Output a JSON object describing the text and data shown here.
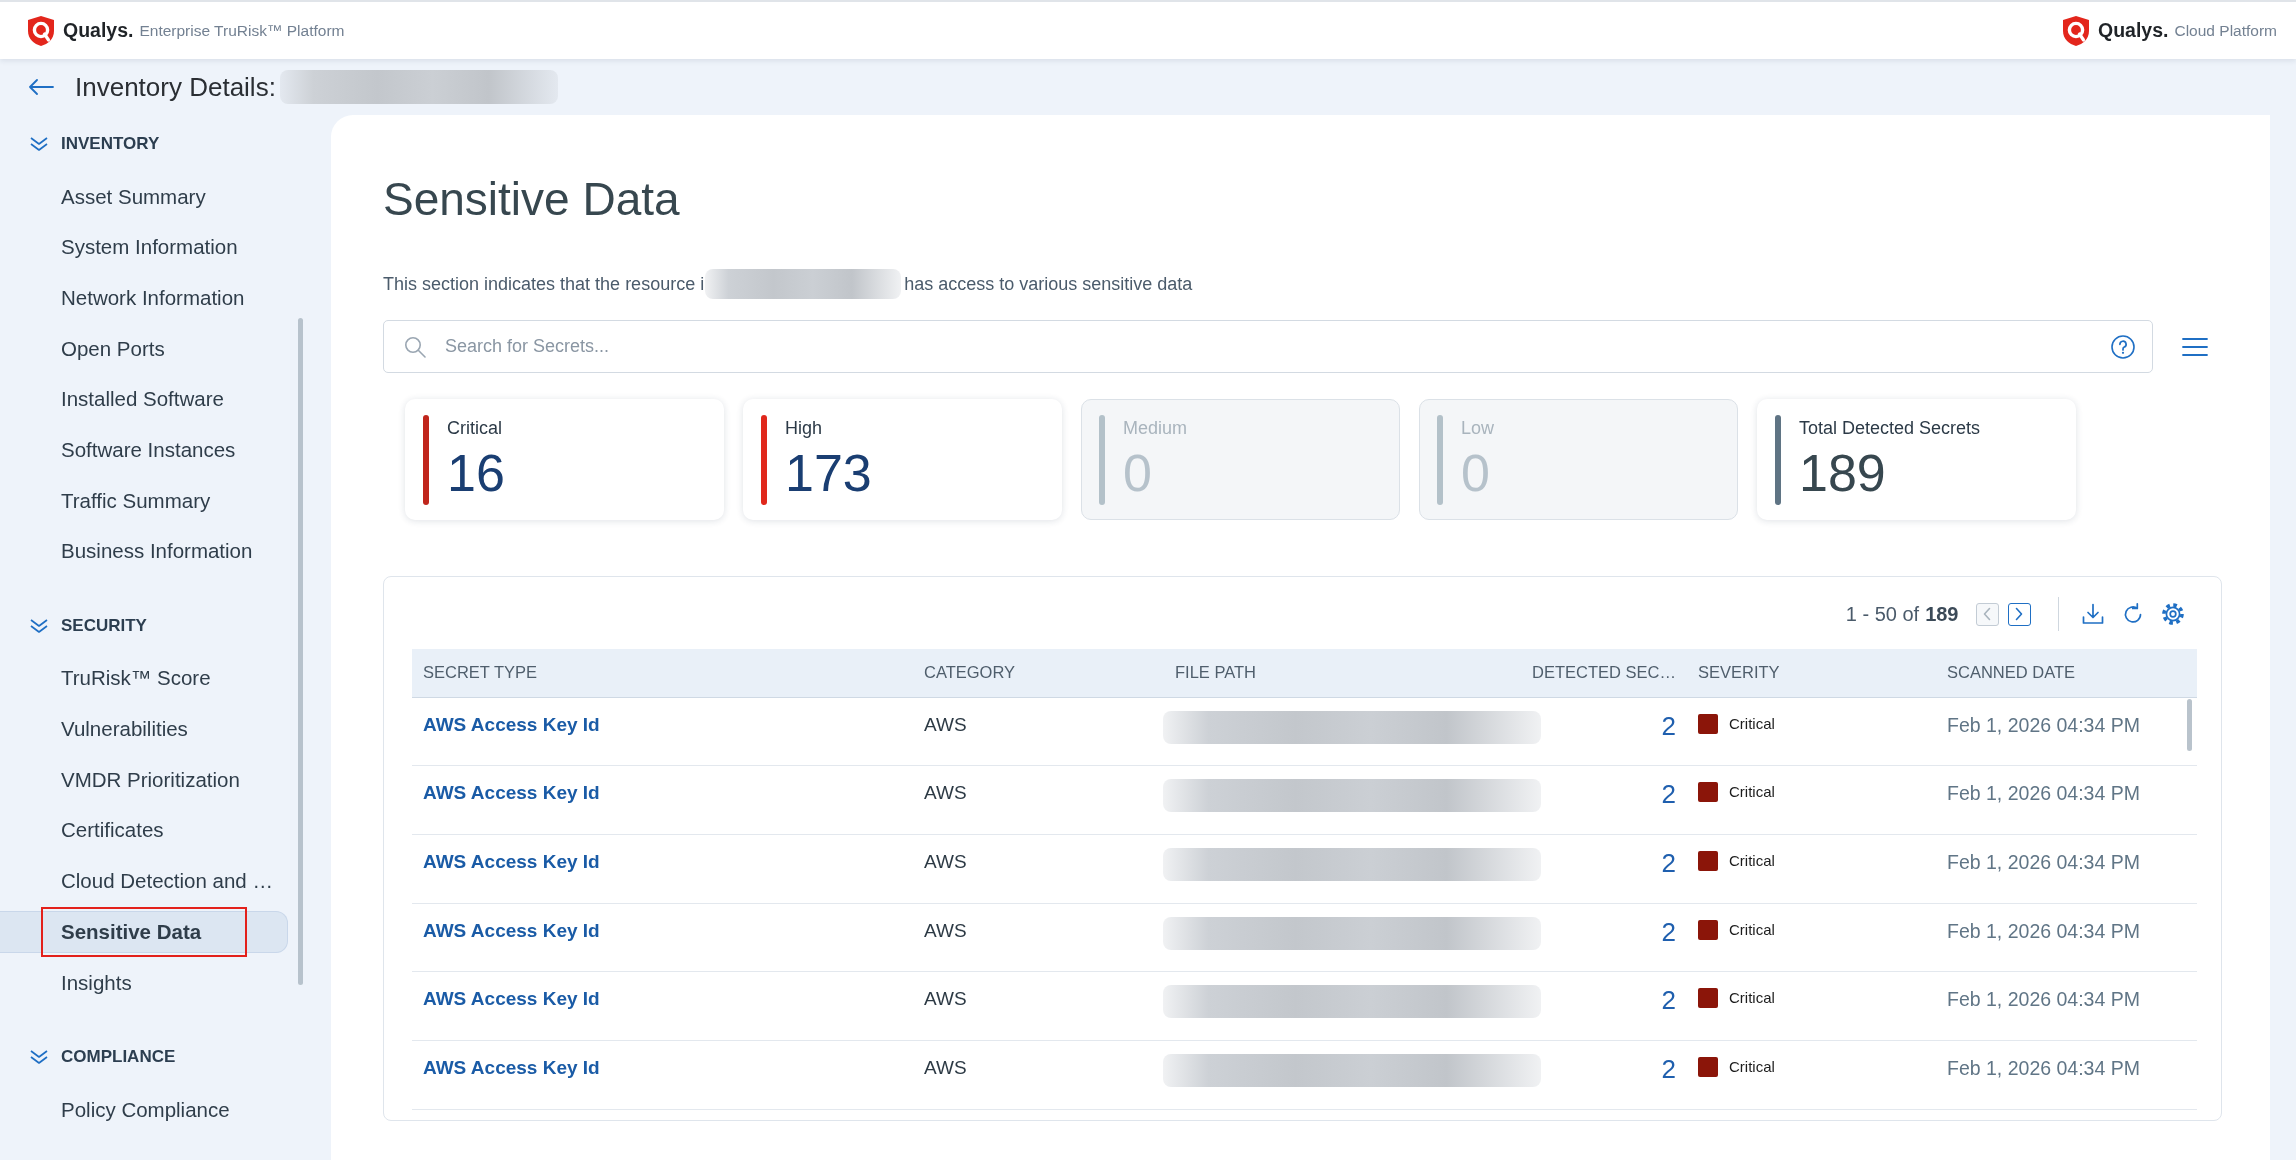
{
  "top_bar": {
    "left_brand": {
      "name": "Qualys.",
      "product": "Enterprise TruRisk™ Platform"
    },
    "right_brand": {
      "name": "Qualys.",
      "product": "Cloud Platform"
    }
  },
  "page_header": {
    "title": "Inventory Details:",
    "value_blurred": true
  },
  "sidebar": {
    "sections": [
      {
        "title": "INVENTORY",
        "expanded": true,
        "items": [
          {
            "label": "Asset Summary",
            "selected": false,
            "highlighted": false
          },
          {
            "label": "System Information",
            "selected": false,
            "highlighted": false
          },
          {
            "label": "Network Information",
            "selected": false,
            "highlighted": false
          },
          {
            "label": "Open Ports",
            "selected": false,
            "highlighted": false
          },
          {
            "label": "Installed Software",
            "selected": false,
            "highlighted": false
          },
          {
            "label": "Software Instances",
            "selected": false,
            "highlighted": false
          },
          {
            "label": "Traffic Summary",
            "selected": false,
            "highlighted": false
          },
          {
            "label": "Business Information",
            "selected": false,
            "highlighted": false
          }
        ]
      },
      {
        "title": "SECURITY",
        "expanded": true,
        "items": [
          {
            "label": "TruRisk™ Score",
            "selected": false,
            "highlighted": false
          },
          {
            "label": "Vulnerabilities",
            "selected": false,
            "highlighted": false
          },
          {
            "label": "VMDR Prioritization",
            "selected": false,
            "highlighted": false
          },
          {
            "label": "Certificates",
            "selected": false,
            "highlighted": false
          },
          {
            "label": "Cloud Detection and …",
            "selected": false,
            "highlighted": false
          },
          {
            "label": "Sensitive Data",
            "selected": true,
            "highlighted": true
          },
          {
            "label": "Insights",
            "selected": false,
            "highlighted": false
          }
        ]
      },
      {
        "title": "COMPLIANCE",
        "expanded": true,
        "items": [
          {
            "label": "Policy Compliance",
            "selected": false,
            "highlighted": false
          }
        ]
      }
    ]
  },
  "content": {
    "title": "Sensitive Data",
    "description": {
      "text_before_blur": "This section indicates that the resource i",
      "blurred": true,
      "text_after_blur": "has access to various sensitive data"
    },
    "search": {
      "placeholder": "Search for Secrets..."
    },
    "summary_cards": [
      {
        "kind": "severity",
        "label": "Critical",
        "value": "16",
        "color": "#c0261c",
        "disabled": false
      },
      {
        "kind": "severity",
        "label": "High",
        "value": "173",
        "color": "#e0281c",
        "disabled": false
      },
      {
        "kind": "severity",
        "label": "Medium",
        "value": "0",
        "color": "#b3c1c9",
        "disabled": true
      },
      {
        "kind": "severity",
        "label": "Low",
        "value": "0",
        "color": "#b3c1c9",
        "disabled": true
      },
      {
        "kind": "total",
        "label": "Total Detected Secrets",
        "value": "189",
        "color": "#5f7484",
        "disabled": false
      }
    ],
    "table": {
      "pagination": {
        "range": "1 - 50 of",
        "total": "189",
        "previous_disabled": true,
        "next_disabled": false
      },
      "columns": [
        {
          "label": "SECRET TYPE",
          "kind": "text"
        },
        {
          "label": "CATEGORY",
          "kind": "text"
        },
        {
          "label": "FILE PATH",
          "kind": "text"
        },
        {
          "label": "DETECTED SEC…",
          "kind": "number"
        },
        {
          "label": "SEVERITY",
          "kind": "text"
        },
        {
          "label": "SCANNED DATE",
          "kind": "text"
        }
      ],
      "rows": [
        {
          "secret_type": "AWS Access Key Id",
          "category": "AWS",
          "file_path_blurred": true,
          "detected_secrets": "2",
          "severity": "Critical",
          "color": "#8b1509",
          "scanned_date": "Feb 1, 2026 04:34 PM"
        },
        {
          "secret_type": "AWS Access Key Id",
          "category": "AWS",
          "file_path_blurred": true,
          "detected_secrets": "2",
          "severity": "Critical",
          "color": "#8b1509",
          "scanned_date": "Feb 1, 2026 04:34 PM"
        },
        {
          "secret_type": "AWS Access Key Id",
          "category": "AWS",
          "file_path_blurred": true,
          "detected_secrets": "2",
          "severity": "Critical",
          "color": "#8b1509",
          "scanned_date": "Feb 1, 2026 04:34 PM"
        },
        {
          "secret_type": "AWS Access Key Id",
          "category": "AWS",
          "file_path_blurred": true,
          "detected_secrets": "2",
          "severity": "Critical",
          "color": "#8b1509",
          "scanned_date": "Feb 1, 2026 04:34 PM"
        },
        {
          "secret_type": "AWS Access Key Id",
          "category": "AWS",
          "file_path_blurred": true,
          "detected_secrets": "2",
          "severity": "Critical",
          "color": "#8b1509",
          "scanned_date": "Feb 1, 2026 04:34 PM"
        },
        {
          "secret_type": "AWS Access Key Id",
          "category": "AWS",
          "file_path_blurred": true,
          "detected_secrets": "2",
          "severity": "Critical",
          "color": "#8b1509",
          "scanned_date": "Feb 1, 2026 04:34 PM"
        }
      ]
    }
  }
}
